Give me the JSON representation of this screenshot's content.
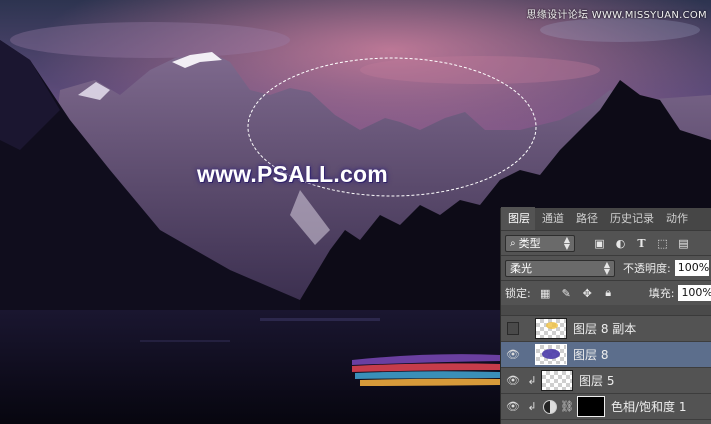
{
  "watermark_top": "思缘设计论坛 WWW.MISSYUAN.COM",
  "watermark_center": "www.PSALL.com",
  "layers_panel": {
    "tabs": [
      "图层",
      "通道",
      "路径",
      "历史记录",
      "动作"
    ],
    "active_tab": "图层",
    "filter": {
      "label": "类型",
      "icon": "search-icon"
    },
    "filter_icons": [
      "image-filter-icon",
      "adjustment-filter-icon",
      "type-filter-icon",
      "shape-filter-icon",
      "smart-object-filter-icon"
    ],
    "blend_mode": "柔光",
    "opacity_label": "不透明度:",
    "opacity_value": "100%",
    "lock_label": "锁定:",
    "fill_label": "填充:",
    "fill_value": "100%",
    "layers": [
      {
        "name": "图层 8 副本",
        "visible": false,
        "selected": false,
        "clipped": false
      },
      {
        "name": "图层 8",
        "visible": true,
        "selected": true,
        "clipped": false
      },
      {
        "name": "图层 5",
        "visible": true,
        "selected": false,
        "clipped": true
      },
      {
        "name": "色相/饱和度 1",
        "visible": true,
        "selected": false,
        "clipped": true,
        "adjustment": true
      }
    ]
  },
  "colors": {
    "panel_bg": "#535353",
    "selection_highlight": "#5c6e8c",
    "sky_purple": "#7a4f8e",
    "sky_pink": "#d07a9a"
  }
}
